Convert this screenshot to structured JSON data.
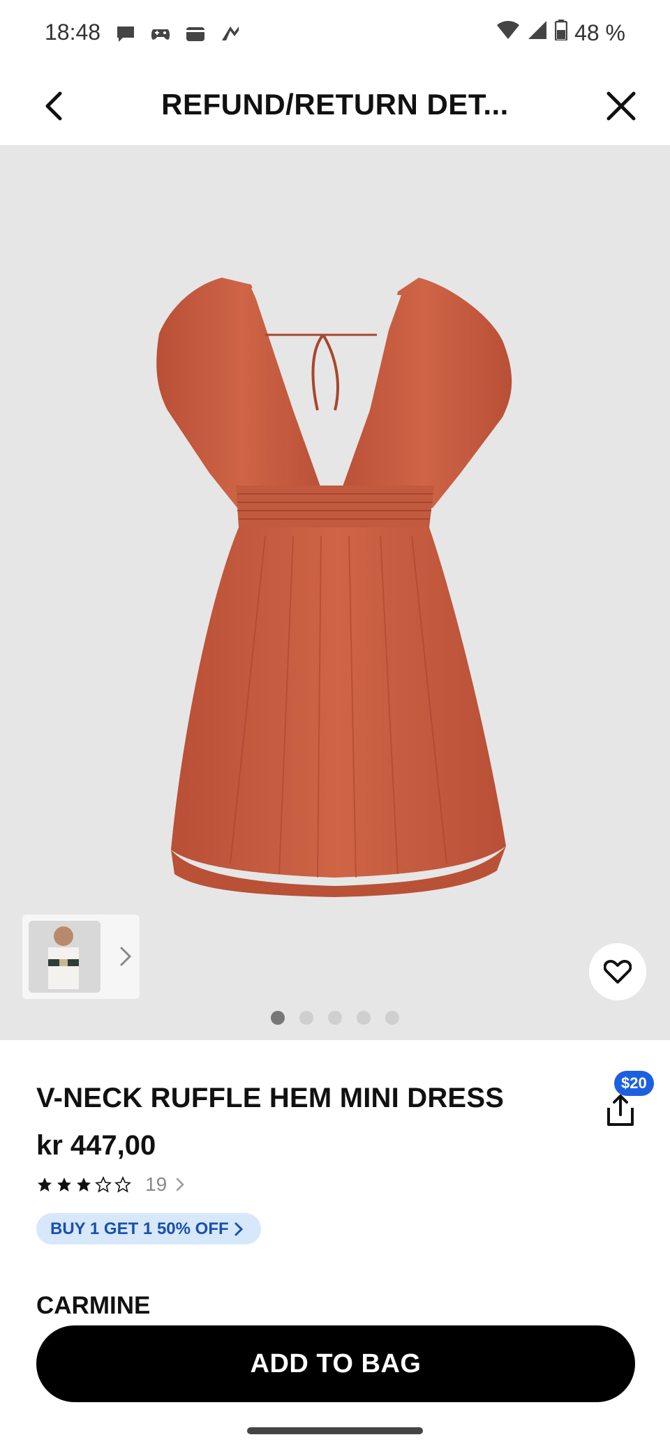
{
  "status_bar": {
    "time": "18:48",
    "battery": "48 %",
    "app_icons": [
      "messages-icon",
      "game-controller-icon",
      "wallet-icon",
      "nav-arrow-icon"
    ],
    "system_icons": [
      "wifi-icon",
      "signal-icon",
      "battery-icon"
    ]
  },
  "nav": {
    "title": "REFUND/RETURN DET..."
  },
  "gallery": {
    "image_count": 5,
    "active_index": 0,
    "product_color_hex": "#c65b40"
  },
  "product": {
    "title": "V-NECK RUFFLE HEM MINI DRESS",
    "price": "kr 447,00",
    "rating": 3,
    "rating_max": 5,
    "review_count": "19",
    "promo": "BUY 1 GET 1 50% OFF",
    "share_badge": "$20",
    "color_label": "CARMINE"
  },
  "cta": {
    "add_to_bag": "ADD TO BAG"
  },
  "colors": {
    "promo_bg": "#d7e8fb",
    "promo_text": "#1a4fb0",
    "badge_blue": "#1c5fe0",
    "cta_bg": "#000000"
  }
}
